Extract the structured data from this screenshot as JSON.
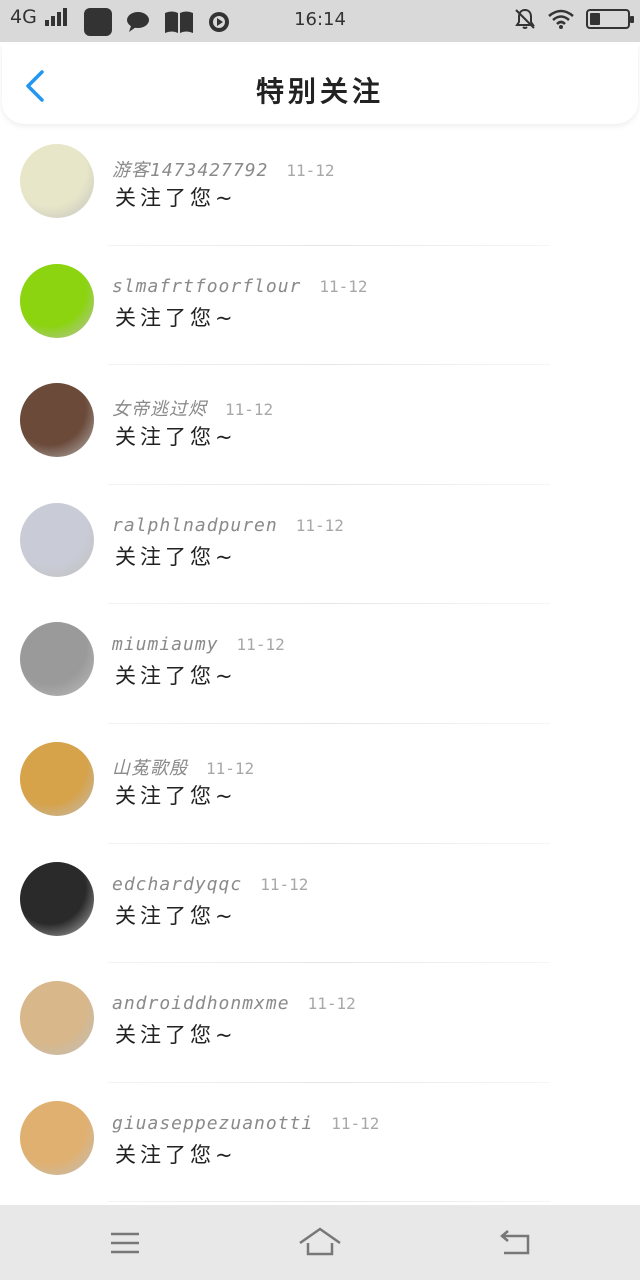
{
  "status_bar": {
    "network": "4G",
    "time": "16:14",
    "icons": [
      "signal-icon",
      "app-icon",
      "message-icon",
      "book-icon",
      "media-icon",
      "mute-icon",
      "wifi-icon",
      "battery-icon"
    ]
  },
  "header": {
    "title": "特别关注",
    "back_icon": "chevron-left-icon",
    "accent_color": "#2196f3"
  },
  "list": {
    "items": [
      {
        "name": "游客1473427792",
        "date": "11-12",
        "message": "关注了您~",
        "avatar_color": "#e8e6c8"
      },
      {
        "name": "slmafrtfoorflour",
        "date": "11-12",
        "message": "关注了您~",
        "avatar_color": "#8bd40f"
      },
      {
        "name": "女帝逃过烬",
        "date": "11-12",
        "message": "关注了您~",
        "avatar_color": "#6b4a3a"
      },
      {
        "name": "ralphlnadpuren",
        "date": "11-12",
        "message": "关注了您~",
        "avatar_color": "#c9ccd6"
      },
      {
        "name": "miumiaumy",
        "date": "11-12",
        "message": "关注了您~",
        "avatar_color": "#9a9a9a"
      },
      {
        "name": "山菟歌殷",
        "date": "11-12",
        "message": "关注了您~",
        "avatar_color": "#d6a24a"
      },
      {
        "name": "edchardyqqc",
        "date": "11-12",
        "message": "关注了您~",
        "avatar_color": "#2a2a2a"
      },
      {
        "name": "androiddhonmxme",
        "date": "11-12",
        "message": "关注了您~",
        "avatar_color": "#d8b78a"
      },
      {
        "name": "giuaseppezuanotti",
        "date": "11-12",
        "message": "关注了您~",
        "avatar_color": "#e0b070"
      }
    ]
  },
  "nav_bar": {
    "icons": [
      "menu-icon",
      "home-icon",
      "back-icon"
    ]
  }
}
